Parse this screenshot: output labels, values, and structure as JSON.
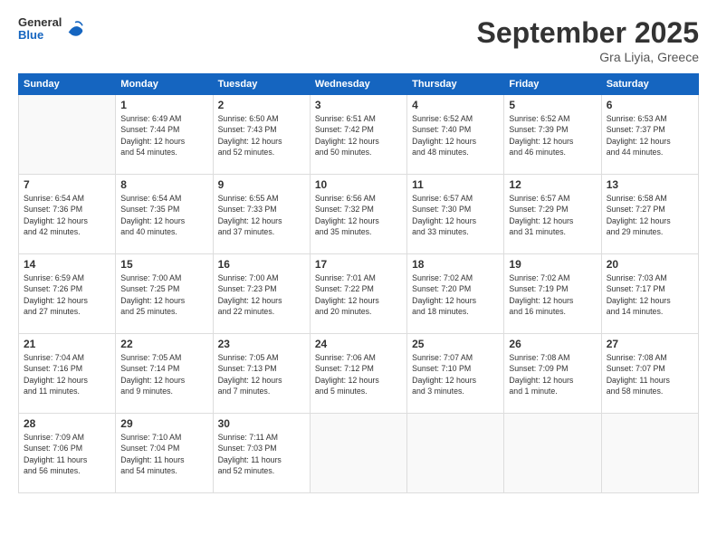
{
  "logo": {
    "general": "General",
    "blue": "Blue"
  },
  "header": {
    "month": "September 2025",
    "location": "Gra Liyia, Greece"
  },
  "weekdays": [
    "Sunday",
    "Monday",
    "Tuesday",
    "Wednesday",
    "Thursday",
    "Friday",
    "Saturday"
  ],
  "weeks": [
    [
      {
        "day": "",
        "info": ""
      },
      {
        "day": "1",
        "info": "Sunrise: 6:49 AM\nSunset: 7:44 PM\nDaylight: 12 hours\nand 54 minutes."
      },
      {
        "day": "2",
        "info": "Sunrise: 6:50 AM\nSunset: 7:43 PM\nDaylight: 12 hours\nand 52 minutes."
      },
      {
        "day": "3",
        "info": "Sunrise: 6:51 AM\nSunset: 7:42 PM\nDaylight: 12 hours\nand 50 minutes."
      },
      {
        "day": "4",
        "info": "Sunrise: 6:52 AM\nSunset: 7:40 PM\nDaylight: 12 hours\nand 48 minutes."
      },
      {
        "day": "5",
        "info": "Sunrise: 6:52 AM\nSunset: 7:39 PM\nDaylight: 12 hours\nand 46 minutes."
      },
      {
        "day": "6",
        "info": "Sunrise: 6:53 AM\nSunset: 7:37 PM\nDaylight: 12 hours\nand 44 minutes."
      }
    ],
    [
      {
        "day": "7",
        "info": "Sunrise: 6:54 AM\nSunset: 7:36 PM\nDaylight: 12 hours\nand 42 minutes."
      },
      {
        "day": "8",
        "info": "Sunrise: 6:54 AM\nSunset: 7:35 PM\nDaylight: 12 hours\nand 40 minutes."
      },
      {
        "day": "9",
        "info": "Sunrise: 6:55 AM\nSunset: 7:33 PM\nDaylight: 12 hours\nand 37 minutes."
      },
      {
        "day": "10",
        "info": "Sunrise: 6:56 AM\nSunset: 7:32 PM\nDaylight: 12 hours\nand 35 minutes."
      },
      {
        "day": "11",
        "info": "Sunrise: 6:57 AM\nSunset: 7:30 PM\nDaylight: 12 hours\nand 33 minutes."
      },
      {
        "day": "12",
        "info": "Sunrise: 6:57 AM\nSunset: 7:29 PM\nDaylight: 12 hours\nand 31 minutes."
      },
      {
        "day": "13",
        "info": "Sunrise: 6:58 AM\nSunset: 7:27 PM\nDaylight: 12 hours\nand 29 minutes."
      }
    ],
    [
      {
        "day": "14",
        "info": "Sunrise: 6:59 AM\nSunset: 7:26 PM\nDaylight: 12 hours\nand 27 minutes."
      },
      {
        "day": "15",
        "info": "Sunrise: 7:00 AM\nSunset: 7:25 PM\nDaylight: 12 hours\nand 25 minutes."
      },
      {
        "day": "16",
        "info": "Sunrise: 7:00 AM\nSunset: 7:23 PM\nDaylight: 12 hours\nand 22 minutes."
      },
      {
        "day": "17",
        "info": "Sunrise: 7:01 AM\nSunset: 7:22 PM\nDaylight: 12 hours\nand 20 minutes."
      },
      {
        "day": "18",
        "info": "Sunrise: 7:02 AM\nSunset: 7:20 PM\nDaylight: 12 hours\nand 18 minutes."
      },
      {
        "day": "19",
        "info": "Sunrise: 7:02 AM\nSunset: 7:19 PM\nDaylight: 12 hours\nand 16 minutes."
      },
      {
        "day": "20",
        "info": "Sunrise: 7:03 AM\nSunset: 7:17 PM\nDaylight: 12 hours\nand 14 minutes."
      }
    ],
    [
      {
        "day": "21",
        "info": "Sunrise: 7:04 AM\nSunset: 7:16 PM\nDaylight: 12 hours\nand 11 minutes."
      },
      {
        "day": "22",
        "info": "Sunrise: 7:05 AM\nSunset: 7:14 PM\nDaylight: 12 hours\nand 9 minutes."
      },
      {
        "day": "23",
        "info": "Sunrise: 7:05 AM\nSunset: 7:13 PM\nDaylight: 12 hours\nand 7 minutes."
      },
      {
        "day": "24",
        "info": "Sunrise: 7:06 AM\nSunset: 7:12 PM\nDaylight: 12 hours\nand 5 minutes."
      },
      {
        "day": "25",
        "info": "Sunrise: 7:07 AM\nSunset: 7:10 PM\nDaylight: 12 hours\nand 3 minutes."
      },
      {
        "day": "26",
        "info": "Sunrise: 7:08 AM\nSunset: 7:09 PM\nDaylight: 12 hours\nand 1 minute."
      },
      {
        "day": "27",
        "info": "Sunrise: 7:08 AM\nSunset: 7:07 PM\nDaylight: 11 hours\nand 58 minutes."
      }
    ],
    [
      {
        "day": "28",
        "info": "Sunrise: 7:09 AM\nSunset: 7:06 PM\nDaylight: 11 hours\nand 56 minutes."
      },
      {
        "day": "29",
        "info": "Sunrise: 7:10 AM\nSunset: 7:04 PM\nDaylight: 11 hours\nand 54 minutes."
      },
      {
        "day": "30",
        "info": "Sunrise: 7:11 AM\nSunset: 7:03 PM\nDaylight: 11 hours\nand 52 minutes."
      },
      {
        "day": "",
        "info": ""
      },
      {
        "day": "",
        "info": ""
      },
      {
        "day": "",
        "info": ""
      },
      {
        "day": "",
        "info": ""
      }
    ]
  ]
}
